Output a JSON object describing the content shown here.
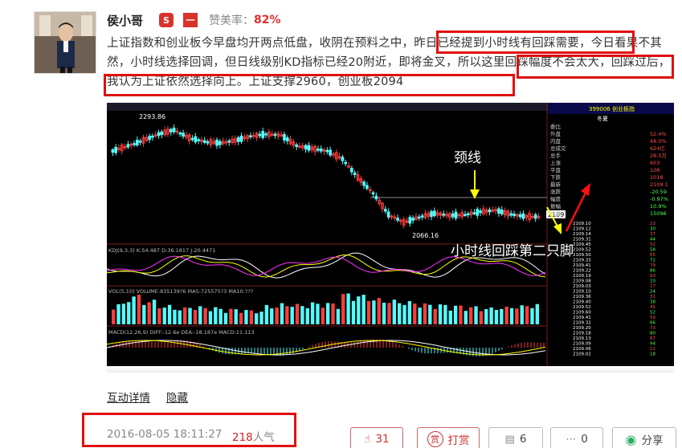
{
  "author": {
    "name": "侯小哥",
    "badge1": "S",
    "badge2": "一",
    "rate_label": "赞美率：",
    "rate_value": "82%"
  },
  "post": {
    "text": "上证指数和创业板今早盘均开两点低盘，收阴在预料之中，昨日已经提到小时线有回踩需要，今日看果不其然，小时线选择回调，但日线级别KD指标已经20附近，即将金叉，所以这里回踩幅度不会太大，回踩过后，我认为上证依然选择向上。上证支撑2960，创业板2094"
  },
  "chart_labels": {
    "neckline": "颈线",
    "second_foot": "小时线回踩第二只脚",
    "top_price": "2293.86",
    "low_price": "2066.16",
    "price_tag": "2109",
    "side_header": "399006 创业板指",
    "side_sub": "冬夏",
    "kdj_label": "KDJ(9,3,3) K:54.487 D:36.1817 J:20.4471",
    "vol_label": "VOL(5,10) VOLUME:835139?6 MA5:725575?3 MA10:???",
    "macd_label": "MACD(12,26,9) DIFF:-12.6e DEA:-18.187e MACD:11.113"
  },
  "side_rows": [
    {
      "k": "委比",
      "v": ""
    },
    {
      "k": "外盘",
      "v": "52.4%"
    },
    {
      "k": "内盘",
      "v": "48.0%"
    },
    {
      "k": "总成交",
      "v": "624亿"
    },
    {
      "k": "总手",
      "v": "28.5万"
    },
    {
      "k": "上涨",
      "v": "603"
    },
    {
      "k": "平盘",
      "v": "108"
    },
    {
      "k": "下跌",
      "v": "1018"
    },
    {
      "k": "最新",
      "v": "2109.1"
    },
    {
      "k": "涨跌",
      "v": "-20.59"
    },
    {
      "k": "幅度",
      "v": "-0.97%"
    },
    {
      "k": "振幅",
      "v": "10.9%"
    },
    {
      "k": "总量",
      "v": "15096"
    }
  ],
  "tick_rows": [
    "2109.10",
    "2109.12",
    "2109.14",
    "2109.31",
    "2109.45",
    "2109.52",
    "2109.50",
    "2109.33",
    "2109.41",
    "2109.22",
    "2109.19",
    "2109.08",
    "2109.03",
    "2109.10",
    "2109.36",
    "2109.40",
    "2109.52",
    "2109.60",
    "2109.41",
    "2109.32",
    "2109.20",
    "2109.18",
    "2109.13",
    "2109.09",
    "2109.06",
    "2109.02"
  ],
  "links": {
    "interact": "互动详情",
    "hide": "隐藏"
  },
  "footer": {
    "time": "2016-08-05 18:11:27",
    "views_num": "218",
    "views_label": "人气"
  },
  "actions": {
    "like_count": "31",
    "reward_label": "打赏",
    "reward_icon": "赏",
    "read_count": "6",
    "comment_count": "0",
    "share_label": "分享"
  },
  "colors": {
    "highlight_red": "#e01010",
    "rate_red": "#e03030",
    "up_red": "#ff3c3c",
    "down_cyan": "#54fcfc",
    "annotation_yellow": "#ffff00"
  },
  "chart_data": {
    "type": "candlestick",
    "title": "",
    "series": [
      {
        "name": "price",
        "values": [
          2230,
          2240,
          2250,
          2262,
          2270,
          2255,
          2248,
          2245,
          2250,
          2258,
          2262,
          2260,
          2240,
          2235,
          2230,
          2215,
          2180,
          2150,
          2110,
          2095,
          2105,
          2112,
          2108,
          2110,
          2115,
          2118,
          2110,
          2106
        ]
      },
      {
        "name": "volume",
        "values": [
          60,
          85,
          70,
          55,
          48,
          52,
          50,
          46,
          44,
          40,
          55,
          60,
          58,
          63,
          62,
          90,
          85,
          75,
          70,
          66,
          60,
          58,
          55,
          52,
          48,
          50,
          54,
          58
        ]
      }
    ],
    "ylim": [
      2060,
      2300
    ]
  }
}
